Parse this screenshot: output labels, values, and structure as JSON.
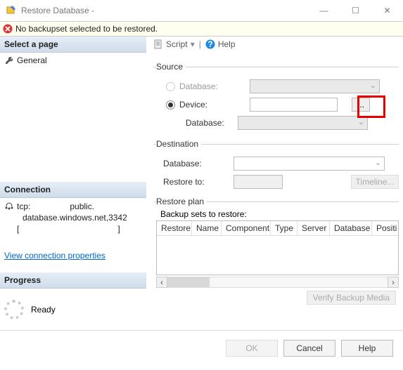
{
  "window": {
    "title": "Restore Database -",
    "minimize": "—",
    "maximize": "☐",
    "close": "✕"
  },
  "notification": {
    "text": "No backupset selected to be restored."
  },
  "leftpanel": {
    "select_page_header": "Select a page",
    "page_general": "General",
    "connection_header": "Connection",
    "conn_line1": "tcp:",
    "conn_line1b": "public.",
    "conn_line2": "database.windows.net,3342",
    "conn_line3_open": "[",
    "conn_line3_close": "]",
    "view_conn_props": "View connection properties",
    "progress_header": "Progress",
    "progress_status": "Ready"
  },
  "toolbar": {
    "script": "Script",
    "help": "Help"
  },
  "source": {
    "legend": "Source",
    "database_opt": "Database:",
    "device_opt": "Device:",
    "database_sub": "Database:",
    "ellipsis": "..."
  },
  "destination": {
    "legend": "Destination",
    "database": "Database:",
    "restore_to": "Restore to:",
    "timeline": "Timeline..."
  },
  "restoreplan": {
    "legend": "Restore plan",
    "backupsets": "Backup sets to restore:",
    "cols": {
      "restore": "Restore",
      "name": "Name",
      "component": "Component",
      "type": "Type",
      "server": "Server",
      "database": "Database",
      "position": "Positi"
    },
    "verify": "Verify Backup Media"
  },
  "footer": {
    "ok": "OK",
    "cancel": "Cancel",
    "help": "Help"
  }
}
